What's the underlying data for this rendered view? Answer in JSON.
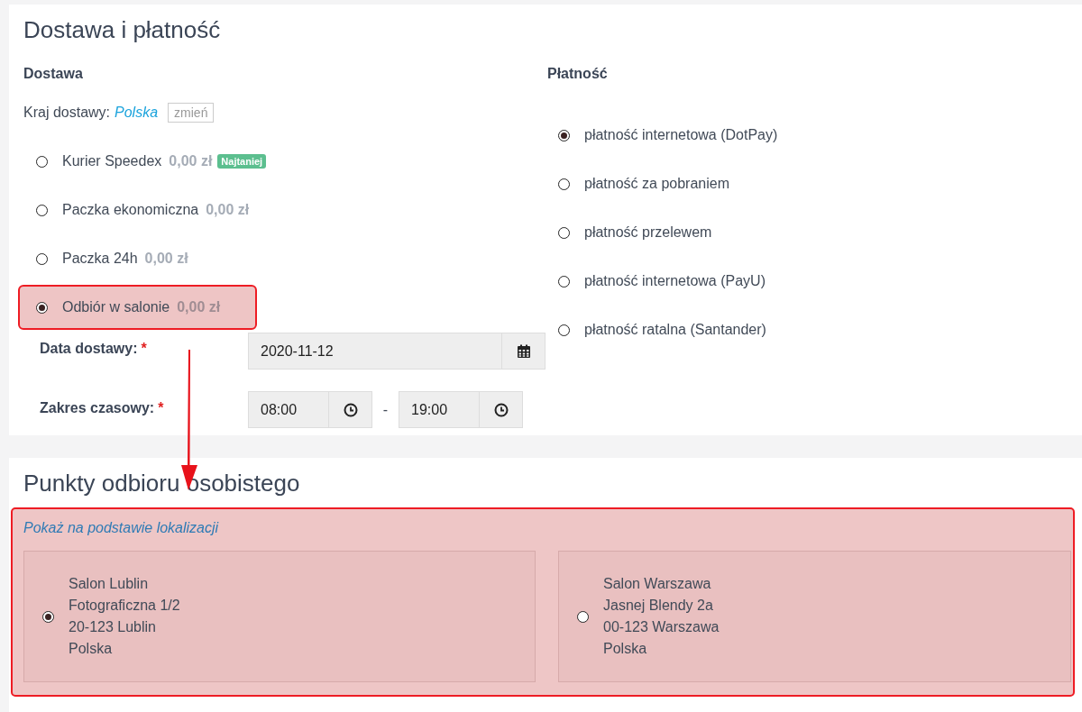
{
  "shipping_section": {
    "title": "Dostawa i płatność",
    "delivery": {
      "heading": "Dostawa",
      "country_label": "Kraj dostawy:",
      "country": "Polska",
      "change_button": "zmień",
      "options": [
        {
          "name": "Kurier Speedex",
          "price": "0,00 zł",
          "badge": "Najtaniej",
          "selected": false,
          "highlighted": false
        },
        {
          "name": "Paczka ekonomiczna",
          "price": "0,00 zł",
          "selected": false,
          "highlighted": false
        },
        {
          "name": "Paczka 24h",
          "price": "0,00 zł",
          "selected": false,
          "highlighted": false
        },
        {
          "name": "Odbiór w salonie",
          "price": "0,00 zł",
          "selected": true,
          "highlighted": true
        }
      ],
      "date": {
        "label": "Data dostawy:",
        "required_mark": "*",
        "value": "2020-11-12"
      },
      "time_range": {
        "label": "Zakres czasowy:",
        "required_mark": "*",
        "from": "08:00",
        "separator": "-",
        "to": "19:00"
      }
    },
    "payment": {
      "heading": "Płatność",
      "options": [
        {
          "name": "płatność internetowa (DotPay)",
          "selected": true
        },
        {
          "name": "płatność za pobraniem",
          "selected": false
        },
        {
          "name": "płatność przelewem",
          "selected": false
        },
        {
          "name": "płatność internetowa (PayU)",
          "selected": false
        },
        {
          "name": "płatność ratalna (Santander)",
          "selected": false
        }
      ]
    }
  },
  "pickup_section": {
    "title": "Punkty odbioru osobistego",
    "highlighted": true,
    "location_link": "Pokaż na podstawie lokalizacji",
    "points": [
      {
        "lines": [
          "Salon Lublin",
          "Fotograficzna 1/2",
          "20-123 Lublin",
          "Polska"
        ],
        "selected": true
      },
      {
        "lines": [
          "Salon Warszawa",
          "Jasnej Blendy 2a",
          "00-123 Warszawa",
          "Polska"
        ],
        "selected": false
      }
    ]
  }
}
